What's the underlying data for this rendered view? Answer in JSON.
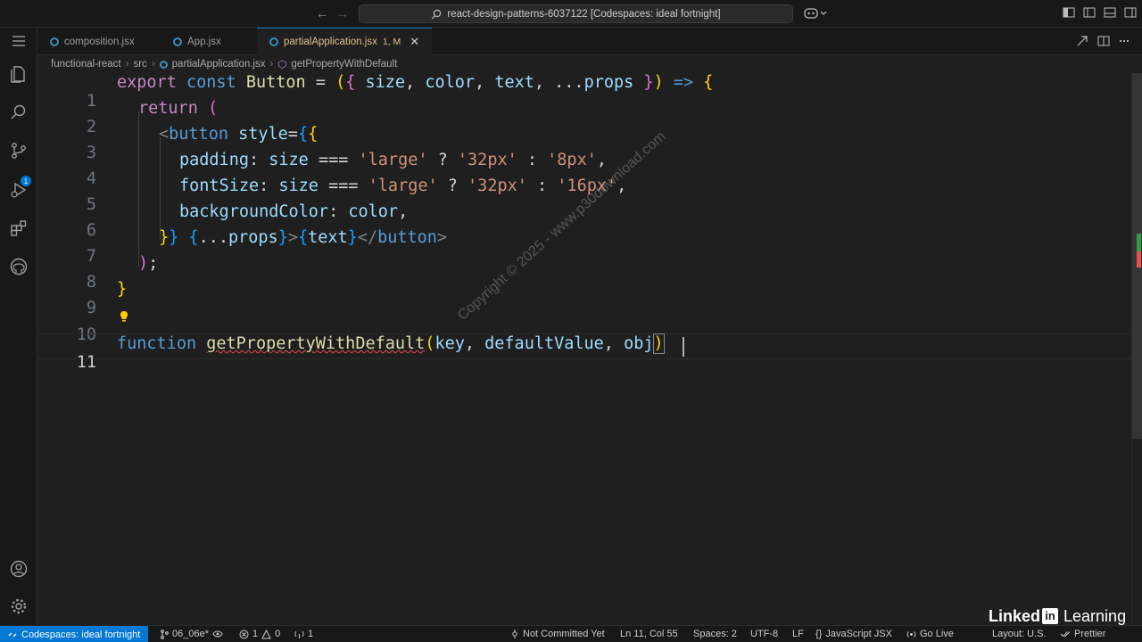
{
  "titlebar": {
    "back": "←",
    "forward": "→",
    "search_text": "react-design-patterns-6037122 [Codespaces: ideal fortnight]"
  },
  "tabs": [
    {
      "label": "composition.jsx"
    },
    {
      "label": "App.jsx"
    },
    {
      "label": "partialApplication.jsx",
      "status": "1, M",
      "close": "✕"
    }
  ],
  "breadcrumb": [
    "functional-react",
    "src",
    "partialApplication.jsx",
    "getPropertyWithDefault"
  ],
  "editor": {
    "line_numbers": [
      "1",
      "2",
      "3",
      "4",
      "5",
      "6",
      "7",
      "8",
      "9",
      "10",
      "11"
    ]
  },
  "code": {
    "l1": {
      "export": "export",
      "const": "const",
      "name": "Button",
      "eq": " = ",
      "p1": "(",
      "b1": "{",
      "size": " size",
      "c1": ", ",
      "color": "color",
      "c2": ", ",
      "text": "text",
      "c3": ", ...",
      "props": "props",
      "b1c": " }",
      "p1c": ")",
      "arrow": " => ",
      "ob": "{"
    },
    "l2": {
      "ret": "return",
      "p": " ("
    },
    "l3": {
      "lt": "<",
      "tag": "button",
      "attr": " style",
      "eq": "=",
      "ob": "{",
      "ob2": "{"
    },
    "l4": {
      "key": "padding",
      "colon": ": ",
      "v": "size",
      "op": " === ",
      "s1": "'large'",
      "q": " ? ",
      "s2": "'32px'",
      "c": " : ",
      "s3": "'8px'",
      "end": ","
    },
    "l5": {
      "key": "fontSize",
      "colon": ": ",
      "v": "size",
      "op": " === ",
      "s1": "'large'",
      "q": " ? ",
      "s2": "'32px'",
      "c": " : ",
      "s3": "'16px'",
      "end": ","
    },
    "l6": {
      "key": "backgroundColor",
      "colon": ": ",
      "v": "color",
      "end": ","
    },
    "l7": {
      "cb2": "}",
      "cb": "}",
      "sp": " ",
      "ob": "{",
      "spread": "...",
      "props": "props",
      "cb3": "}",
      "gt": ">",
      "ob4": "{",
      "text": "text",
      "cb4": "}",
      "close": "</",
      "tag": "button",
      "gt2": ">"
    },
    "l8": {
      "p": ")",
      "semi": ";"
    },
    "l9": {
      "cb": "}"
    },
    "l11": {
      "function": "function",
      "name": "getPropertyWithDefault",
      "p": "(",
      "key": "key",
      "c1": ", ",
      "dv": "defaultValue",
      "c2": ", ",
      "obj": "obj",
      "pc": ")"
    }
  },
  "watermark": "Copyright © 2025 - www.p30download.com",
  "status": {
    "remote": "Codespaces: ideal fortnight",
    "branch": "06_06e*",
    "errors": "1",
    "warnings": "0",
    "ports": "1",
    "blame": "Not Committed Yet",
    "position": "Ln 11, Col 55",
    "spaces": "Spaces: 2",
    "encoding": "UTF-8",
    "eol": "LF",
    "language": "JavaScript JSX",
    "golive": "Go Live",
    "layout": "Layout: U.S.",
    "prettier": "Prettier"
  },
  "logo": {
    "linked": "Linked",
    "in": "in",
    "learning": "Learning"
  },
  "colors": {
    "accent": "#0078d4",
    "editor_bg": "#1f1f1f",
    "chrome_bg": "#181818"
  }
}
